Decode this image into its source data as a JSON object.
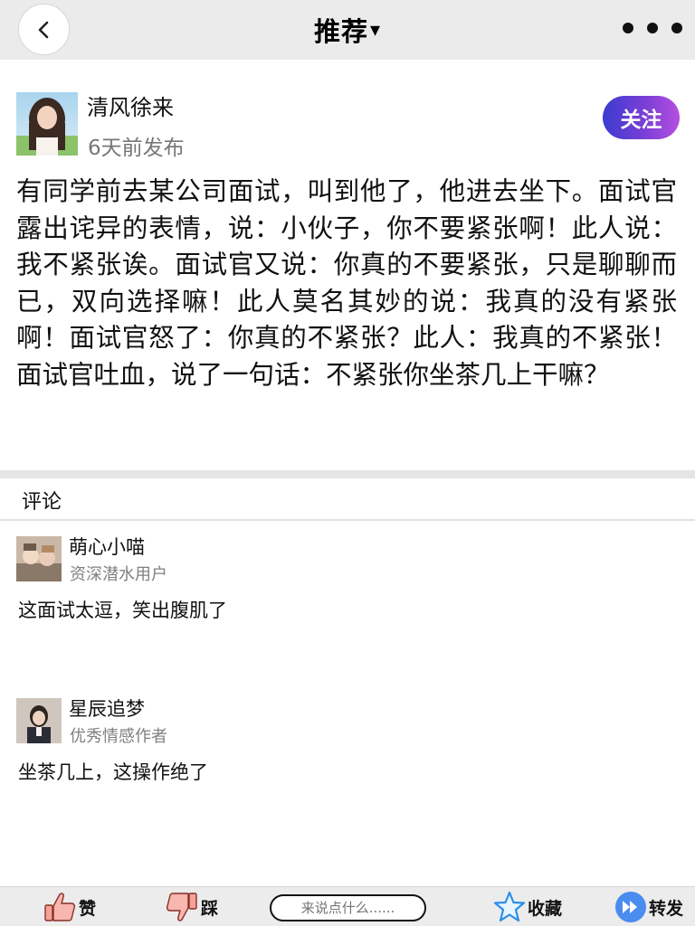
{
  "colors": {
    "accent_gradient_start": "#3b3bcf",
    "accent_gradient_end": "#b44fe0",
    "nav_bg": "#ebebeb",
    "muted_text": "#777777"
  },
  "nav": {
    "back_icon": "chevron-left-icon",
    "title": "推荐",
    "title_caret": "▾",
    "more_icon": "three-dots-icon"
  },
  "post": {
    "author": "清风徐来",
    "time": "6天前发布",
    "follow_label": "关注",
    "content": "有同学前去某公司面试，叫到他了，他进去坐下。面试官露出诧异的表情，说：小伙子，你不要紧张啊！此人说：我不紧张诶。面试官又说：你真的不要紧张，只是聊聊而已，双向选择嘛！此人莫名其妙的说：我真的没有紧张啊！面试官怒了：你真的不紧张？此人：我真的不紧张！面试官吐血，说了一句话：不紧张你坐茶几上干嘛？"
  },
  "comments_section": {
    "title": "评论",
    "items": [
      {
        "name": "萌心小喵",
        "role": "资深潜水用户",
        "text": "这面试太逗，笑出腹肌了"
      },
      {
        "name": "星辰追梦",
        "role": "优秀情感作者",
        "text": "坐茶几上，这操作绝了"
      }
    ]
  },
  "bottom_bar": {
    "like_label": "赞",
    "dislike_label": "踩",
    "input_placeholder": "来说点什么......",
    "favorite_label": "收藏",
    "share_label": "转发"
  }
}
